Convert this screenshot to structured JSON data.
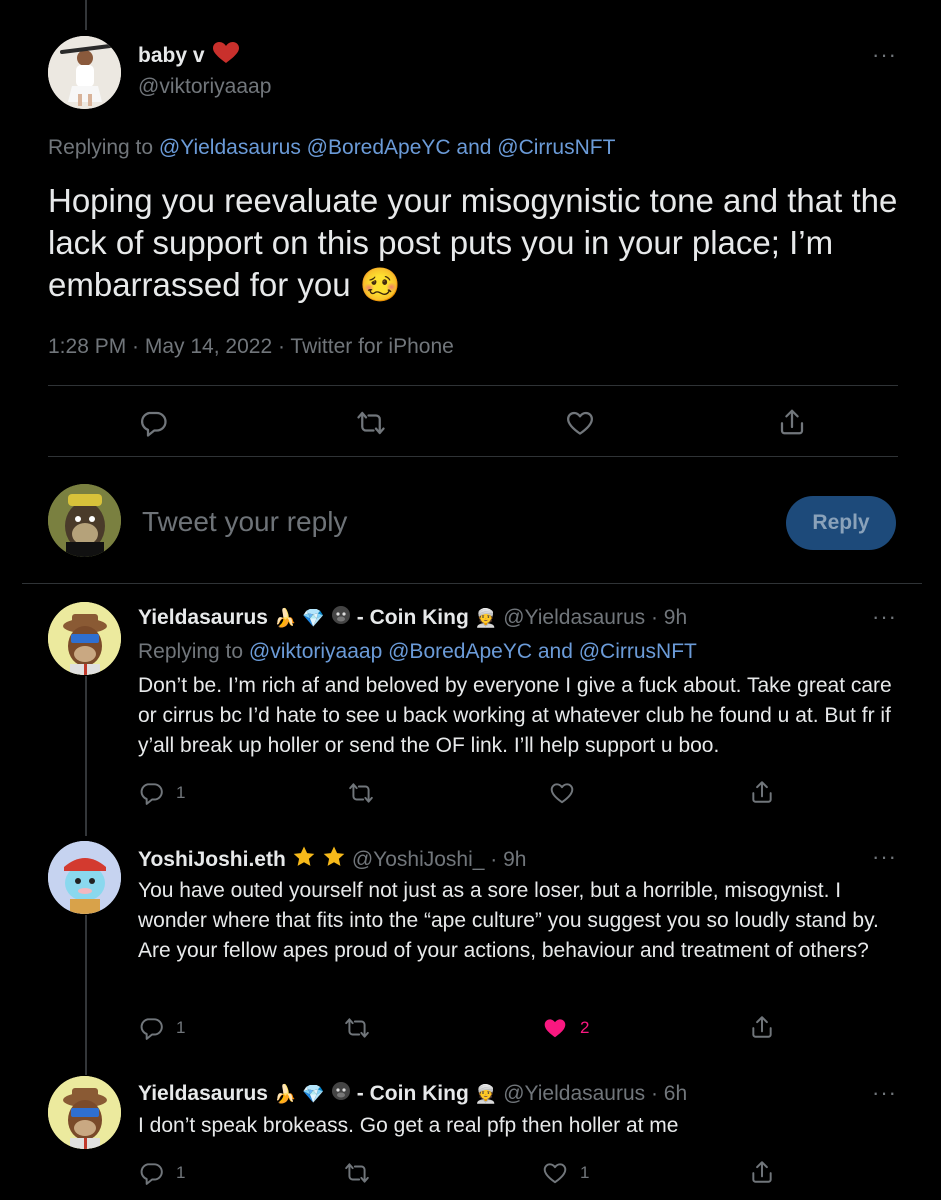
{
  "main_tweet": {
    "display_name": "baby v",
    "handle": "@viktoriyaaap",
    "replying_prefix": "Replying to",
    "replying_mentions": "@Yieldasaurus @BoredApeYC and @CirrusNFT",
    "text": "Hoping you reevaluate your misogynistic tone and that the lack of support on this post puts you in your place; I’m embarrassed for you",
    "emoji": "🥴",
    "timestamp": "1:28 PM · May 14, 2022 · Twitter for iPhone"
  },
  "composer": {
    "placeholder": "Tweet your reply",
    "button_label": "Reply"
  },
  "replies": [
    {
      "display_name": "Yieldasaurus",
      "name_suffix": "- Coin King",
      "handle_time": "@Yieldasaurus · 9h",
      "replying_prefix": "Replying to",
      "replying_mentions": "@viktoriyaaap @BoredApeYC and @CirrusNFT",
      "text": "Don’t be. I’m rich af and beloved by everyone I give a fuck about. Take great care or cirrus bc I’d hate to see u back working at whatever club he found u at. But fr if y’all break up holler or send the OF link. I’ll help support u boo.",
      "reply_count": "1",
      "like_count": ""
    },
    {
      "display_name": "YoshiJoshi.eth",
      "handle_time": "@YoshiJoshi_ · 9h",
      "text": "You have outed yourself not just as a sore loser, but a horrible, misogynist. I wonder where that fits into the “ape culture” you suggest you so loudly stand by. Are your fellow apes proud of your actions, behaviour and treatment of others?",
      "reply_count": "1",
      "like_count": "2"
    },
    {
      "display_name": "Yieldasaurus",
      "name_suffix": "- Coin King",
      "handle_time": "@Yieldasaurus · 6h",
      "text": "I don’t speak brokeass. Go get a real pfp then holler at me",
      "reply_count": "1",
      "like_count": "1"
    }
  ],
  "colors": {
    "background": "#000000",
    "link": "#6b9bd8",
    "muted": "#71767b",
    "liked": "#f91880",
    "reply_button": "#1d4a7a"
  }
}
